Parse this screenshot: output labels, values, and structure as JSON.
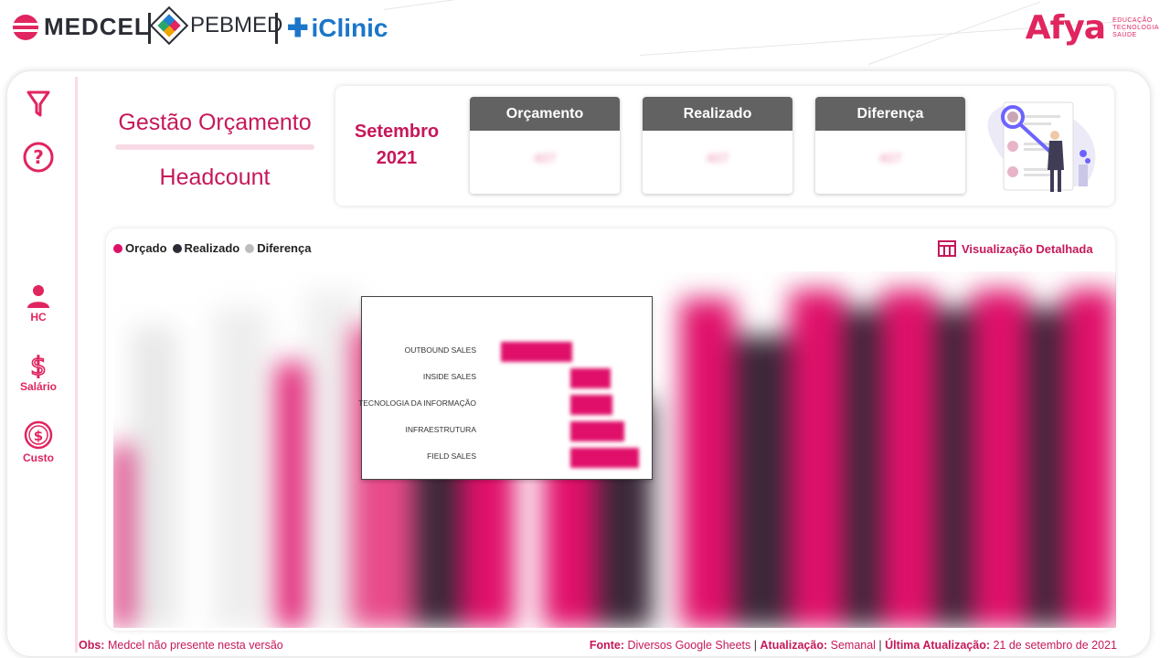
{
  "header": {
    "brands": [
      "MEDCEL",
      "PEBMED",
      "iClinic"
    ],
    "corporate": {
      "name": "Afya",
      "tagline": [
        "EDUCAÇÃO",
        "TECNOLOGIA",
        "SAÚDE"
      ]
    }
  },
  "sidebar": {
    "items": [
      {
        "icon": "filter-icon",
        "label": ""
      },
      {
        "icon": "help-icon",
        "label": ""
      },
      {
        "icon": "person-icon",
        "label": "HC"
      },
      {
        "icon": "dollar-icon",
        "label": "Salário"
      },
      {
        "icon": "coin-icon",
        "label": "Custo"
      }
    ]
  },
  "title": {
    "line1": "Gestão Orçamento",
    "line2": "Headcount"
  },
  "period": {
    "month": "Setembro",
    "year": "2021"
  },
  "kpis": [
    {
      "label": "Orçamento",
      "value": "407"
    },
    {
      "label": "Realizado",
      "value": "407"
    },
    {
      "label": "Diferença",
      "value": "407"
    }
  ],
  "legend": [
    {
      "label": "Orçado",
      "color": "#e0106a"
    },
    {
      "label": "Realizado",
      "color": "#2b2d35"
    },
    {
      "label": "Diferença",
      "color": "#bdbdbd"
    }
  ],
  "detail_link": "Visualização Detalhada",
  "tooltip": {
    "rows": [
      {
        "label": "OUTBOUND SALES",
        "value": 0.62
      },
      {
        "label": "INSIDE SALES",
        "value": 0.35
      },
      {
        "label": "TECNOLOGIA DA INFORMAÇÃO",
        "value": 0.37
      },
      {
        "label": "INFRAESTRUTURA",
        "value": 0.47
      },
      {
        "label": "FIELD SALES",
        "value": 0.6
      }
    ]
  },
  "footer": {
    "obs_label": "Obs:",
    "obs_text": " Medcel não presente nesta versão",
    "fonte_label": "Fonte:",
    "fonte_text": " Diversos Google Sheets ",
    "atualizacao_label": "Atualização:",
    "atualizacao_text": " Semanal ",
    "ultima_label": "Última Atualização:",
    "ultima_text": " 21 de setembro de 2021",
    "separator": "|"
  },
  "colors": {
    "accent": "#e0255f",
    "dark": "#2b2d35",
    "header_gray": "#626262"
  }
}
